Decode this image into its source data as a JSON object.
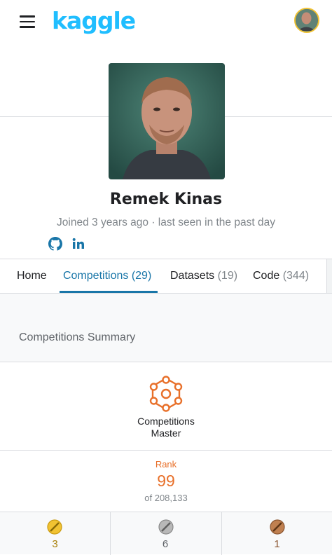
{
  "app": {
    "logo_text": "kaggle"
  },
  "header": {
    "menu_icon": "hamburger-menu-icon",
    "user_avatar_icon": "user-avatar"
  },
  "profile": {
    "name": "Remek Kinas",
    "joined_text": "Joined 3 years ago · last seen in the past day",
    "social_links": [
      "github-icon",
      "linkedin-icon"
    ]
  },
  "tabs": [
    {
      "label": "Home",
      "count": ""
    },
    {
      "label": "Competitions",
      "count": "(29)"
    },
    {
      "label": "Datasets",
      "count": "(19)"
    },
    {
      "label": "Code",
      "count": "(344)"
    }
  ],
  "active_tab": "Competitions",
  "summary": {
    "title": "Competitions Summary",
    "tier_line1": "Competitions",
    "tier_line2": "Master",
    "rank_label": "Rank",
    "rank_value": "99",
    "rank_of": "of 208,133"
  },
  "medals": [
    {
      "type": "gold",
      "count": "3",
      "color": "#f1c232"
    },
    {
      "type": "silver",
      "count": "6",
      "color": "#9e9e9e"
    },
    {
      "type": "bronze",
      "count": "1",
      "color": "#a86a3c"
    }
  ],
  "colors": {
    "brand": "#20beff",
    "accent_tab": "#1976a8",
    "master_orange": "#e8702a"
  }
}
